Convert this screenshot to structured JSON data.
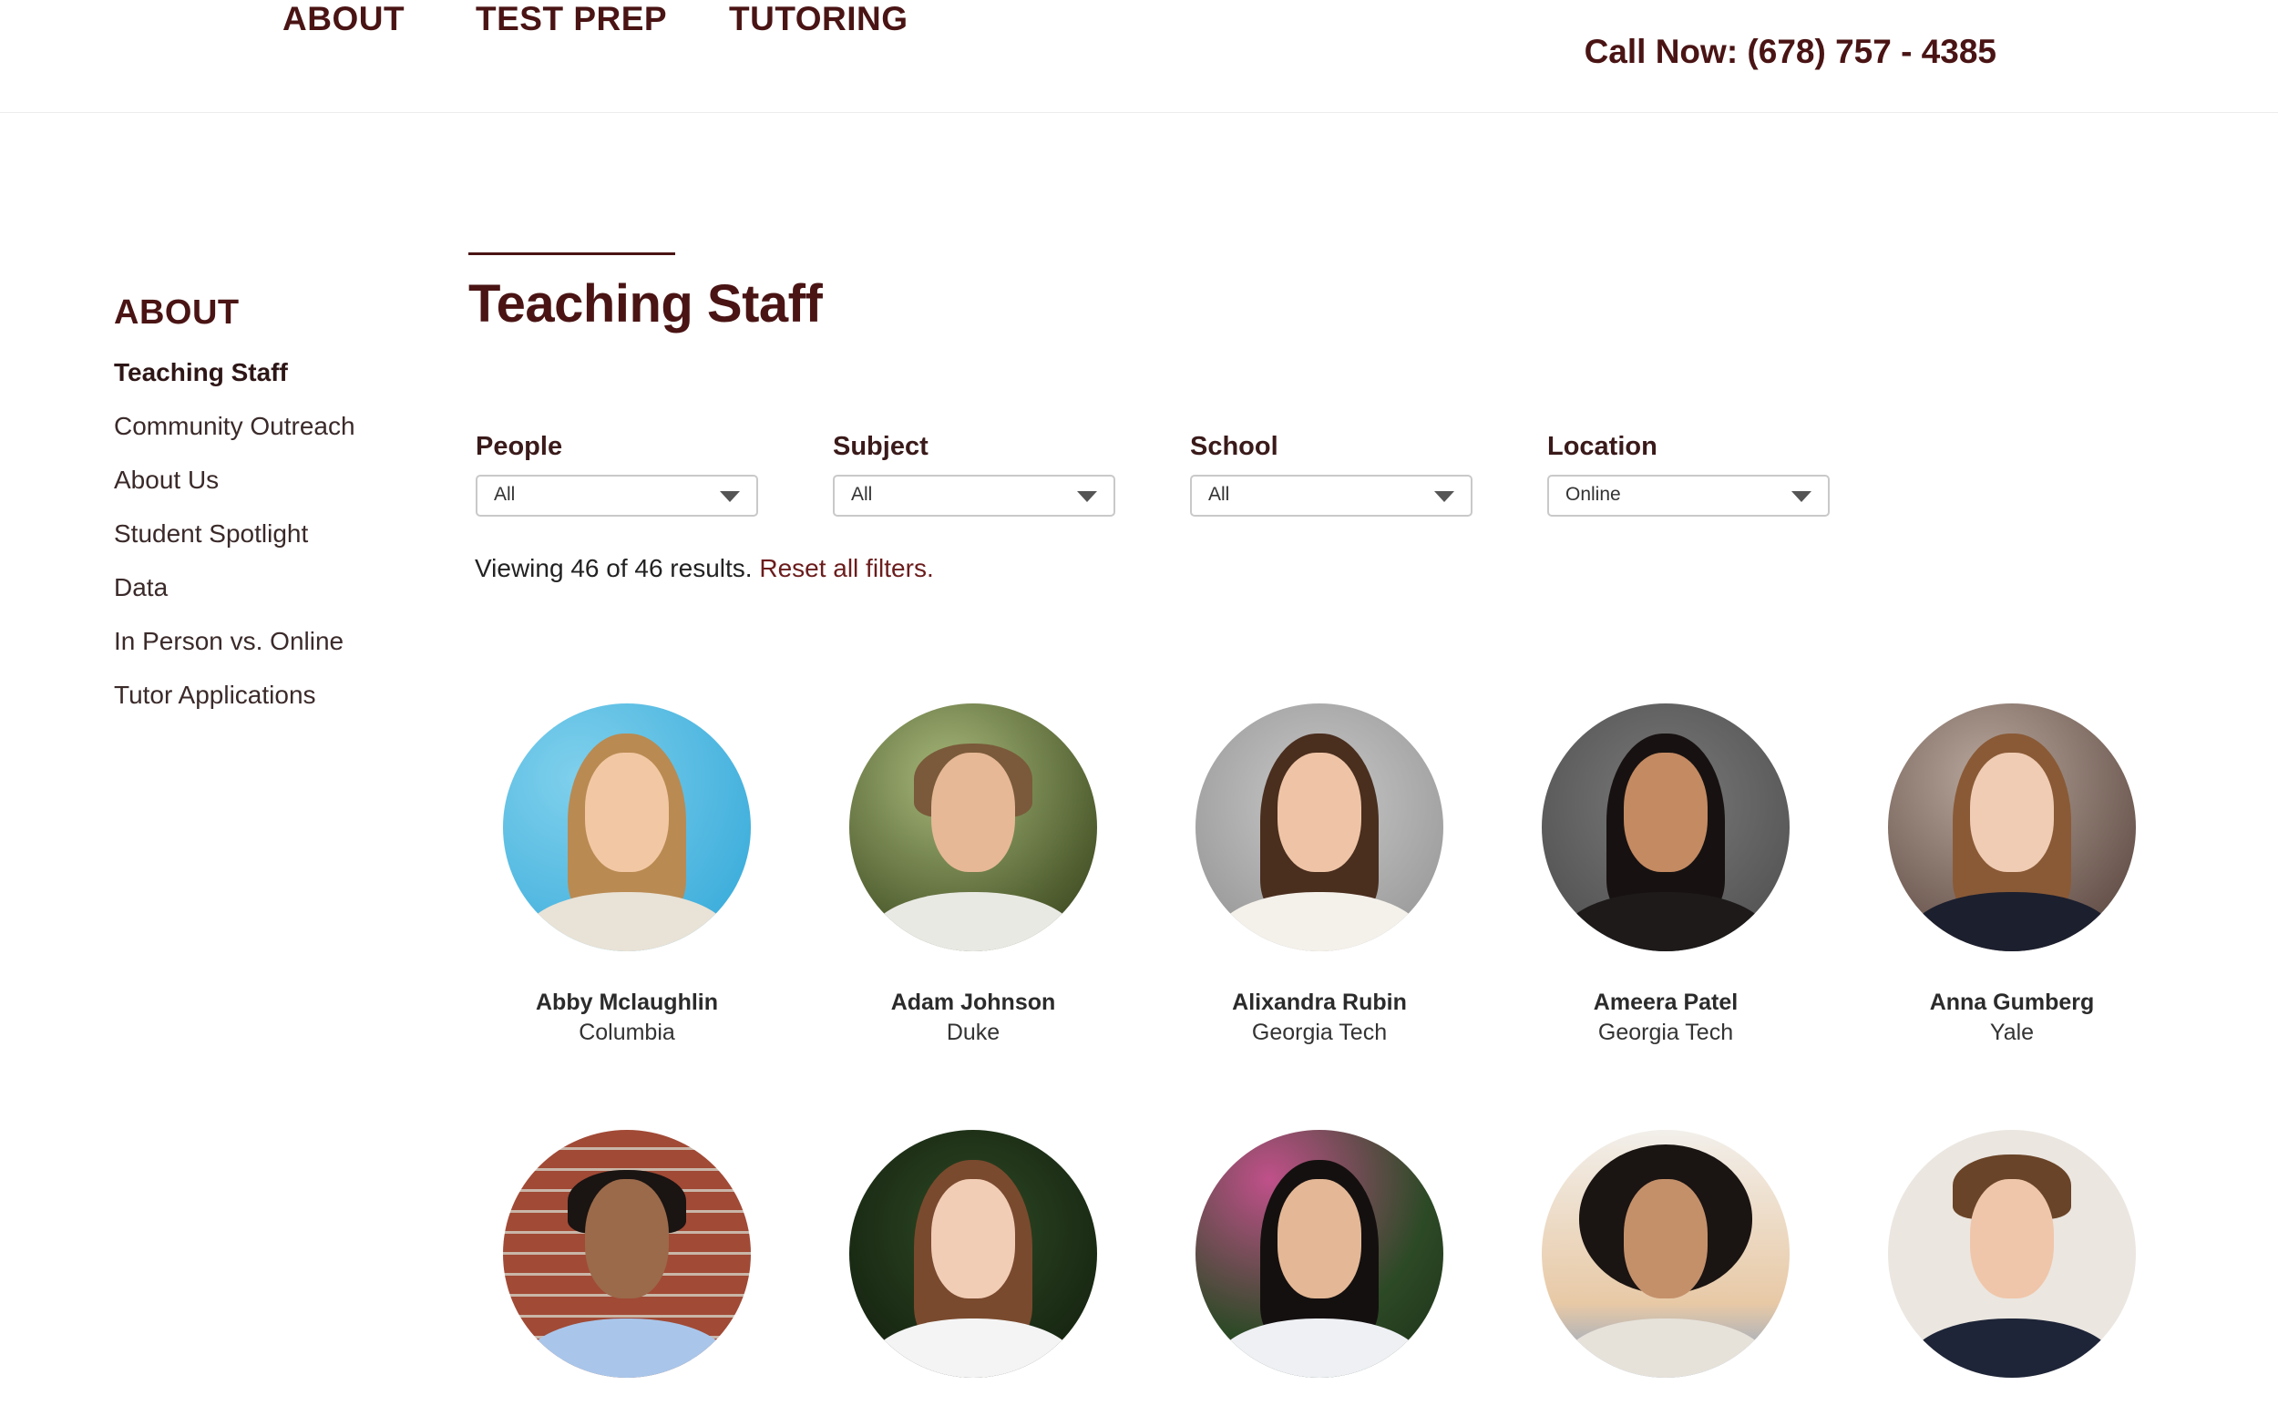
{
  "nav": {
    "items": [
      "ABOUT",
      "TEST PREP",
      "TUTORING"
    ],
    "phone": "Call Now: (678) 757 - 4385"
  },
  "sidebar": {
    "title": "ABOUT",
    "items": [
      {
        "label": "Teaching Staff",
        "active": true
      },
      {
        "label": "Community Outreach"
      },
      {
        "label": "About Us"
      },
      {
        "label": "Student Spotlight"
      },
      {
        "label": "Data"
      },
      {
        "label": "In Person vs. Online"
      },
      {
        "label": "Tutor Applications"
      }
    ]
  },
  "page": {
    "title": "Teaching Staff"
  },
  "filters": [
    {
      "label": "People",
      "value": "All"
    },
    {
      "label": "Subject",
      "value": "All"
    },
    {
      "label": "School",
      "value": "All"
    },
    {
      "label": "Location",
      "value": "Online"
    }
  ],
  "results": {
    "text": "Viewing 46 of 46 results.",
    "reset_label": "Reset all filters."
  },
  "colors": {
    "brand": "#4a1414",
    "link": "#6b1c1c"
  },
  "tutors": [
    {
      "name": "Abby Mclaughlin",
      "school": "Columbia"
    },
    {
      "name": "Adam Johnson",
      "school": "Duke"
    },
    {
      "name": "Alixandra Rubin",
      "school": "Georgia Tech"
    },
    {
      "name": "Ameera Patel",
      "school": "Georgia Tech"
    },
    {
      "name": "Anna Gumberg",
      "school": "Yale"
    },
    {
      "name": "",
      "school": ""
    },
    {
      "name": "",
      "school": ""
    },
    {
      "name": "",
      "school": ""
    },
    {
      "name": "",
      "school": ""
    },
    {
      "name": "",
      "school": ""
    }
  ]
}
